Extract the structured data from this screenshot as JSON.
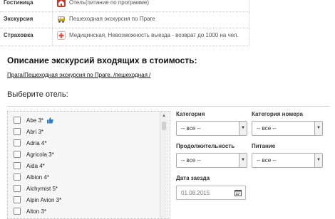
{
  "services": [
    {
      "label": "Гостиница",
      "text": "Отель(питание по программе)",
      "icon": "hotel-icon",
      "icon_color": "#c0392b"
    },
    {
      "label": "Экскурсия",
      "text": "Пешеходная экскурсия по Праге",
      "icon": "bus-icon",
      "icon_color": "#d4a017"
    },
    {
      "label": "Страховка",
      "text": "Медицинская, Невозможность выезда - возврат до 1000 на чел.",
      "icon": "medical-icon",
      "icon_color": "#e74c3c"
    }
  ],
  "excursions": {
    "title": "Описание экскурсий входящих в стоимость:",
    "link": "Прага/Пешеходная экскурсия по Праге. /пешеходная /"
  },
  "hotel_select": {
    "label": "Выберите отель:",
    "hotels": [
      "Abe 3*",
      "Abri 3*",
      "Adria 4*",
      "Agricola 3*",
      "Aida 4*",
      "Albion 4*",
      "Alchymist 5*",
      "Alpin Avion 3*",
      "Alton 3*"
    ],
    "liked_hotel_index": 0
  },
  "filters": {
    "category": {
      "label": "Категория",
      "value": "-- все --"
    },
    "room_category": {
      "label": "Категория номера",
      "value": "-- все --"
    },
    "duration": {
      "label": "Продолжительность",
      "value": "-- все --"
    },
    "meals": {
      "label": "Питание",
      "value": "-- все --"
    },
    "arrival_date": {
      "label": "Дата заезда",
      "value": "01.08.2015"
    }
  },
  "colors": {
    "accent": "#2a7dc9",
    "border": "#cfcfcf"
  }
}
